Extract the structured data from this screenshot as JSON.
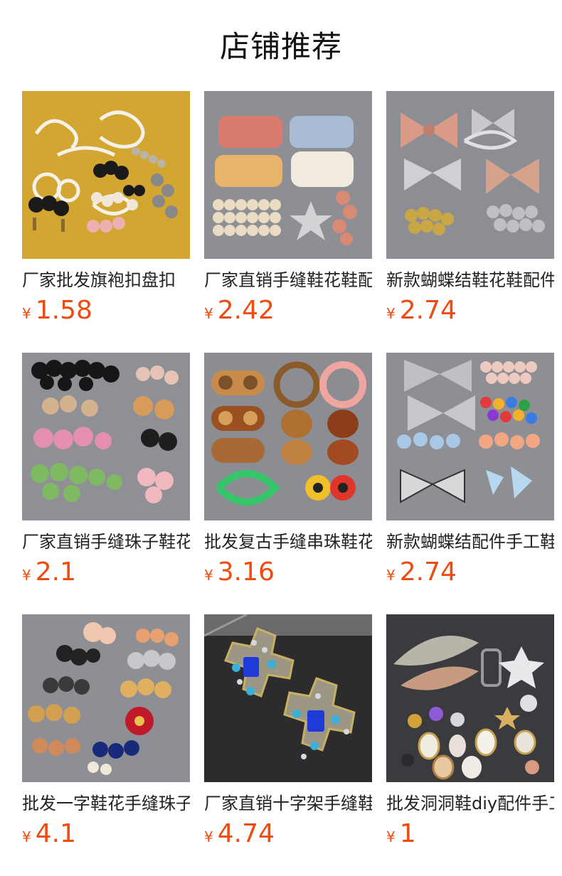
{
  "page": {
    "title": "店铺推荐"
  },
  "colors": {
    "price": "#ee4b0f",
    "text": "#222222"
  },
  "products": [
    {
      "name": "厂家批发旗袍扣盘扣",
      "currency": "¥",
      "price": "1.58",
      "image": "pankou-buttons-on-yellow"
    },
    {
      "name": "厂家直销手缝鞋花鞋配件",
      "currency": "¥",
      "price": "2.42",
      "image": "sequin-pearl-shoe-flowers"
    },
    {
      "name": "新款蝴蝶结鞋花鞋配件",
      "currency": "¥",
      "price": "2.74",
      "image": "rhinestone-bows"
    },
    {
      "name": "厂家直销手缝珠子鞋花",
      "currency": "¥",
      "price": "2.1",
      "image": "beaded-clusters"
    },
    {
      "name": "批发复古手缝串珠鞋花",
      "currency": "¥",
      "price": "3.16",
      "image": "vintage-beaded-gems"
    },
    {
      "name": "新款蝴蝶结配件手工鞋花",
      "currency": "¥",
      "price": "2.74",
      "image": "bows-and-beads"
    },
    {
      "name": "批发一字鞋花手缝珠子",
      "currency": "¥",
      "price": "4.1",
      "image": "mixed-flower-ornaments"
    },
    {
      "name": "厂家直销十字架手缝鞋花",
      "currency": "¥",
      "price": "4.74",
      "image": "cross-rhinestone-patches"
    },
    {
      "name": "批发洞洞鞋diy配件手工",
      "currency": "¥",
      "price": "1",
      "image": "assorted-charms"
    }
  ]
}
